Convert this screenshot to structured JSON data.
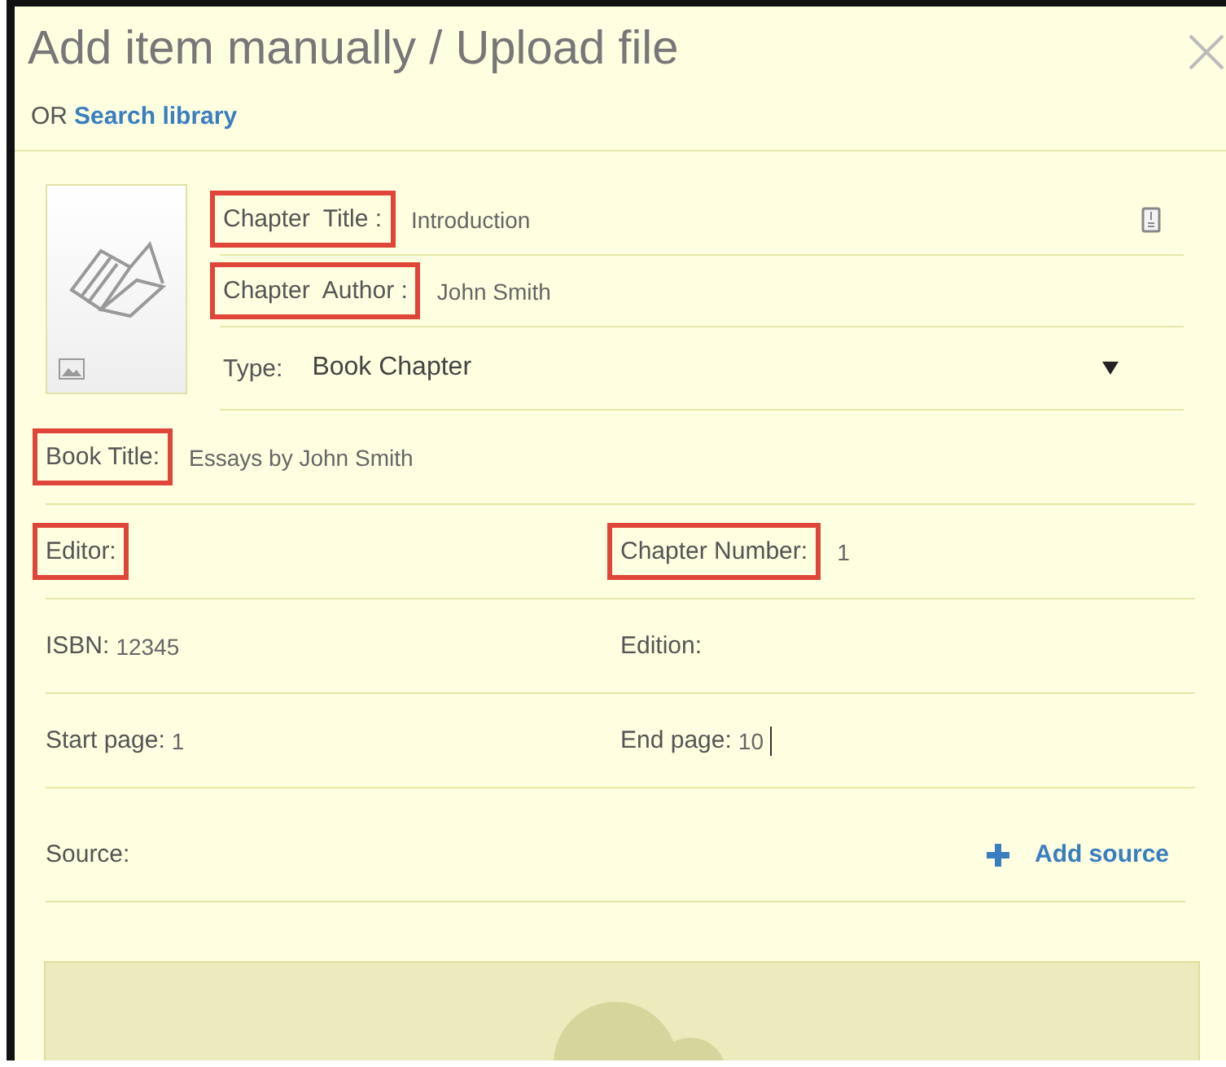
{
  "dialog": {
    "title": "Add item manually / Upload file",
    "or_text": "OR",
    "search_link": "Search library"
  },
  "header_fields": [
    {
      "kind": "text",
      "label": "Chapter  Title :",
      "value": "Introduction",
      "highlighted": true
    },
    {
      "kind": "text",
      "label": "Chapter  Author :",
      "value": "John Smith",
      "highlighted": true
    },
    {
      "kind": "select",
      "label": "Type:",
      "value": "Book Chapter"
    }
  ],
  "rows": [
    [
      {
        "label": "Book Title:",
        "value": "Essays by John Smith",
        "highlighted": true
      }
    ],
    [
      {
        "label": "Editor:",
        "highlighted": true
      },
      {
        "label": "Chapter Number:",
        "value": "1",
        "highlighted": true
      }
    ],
    [
      {
        "label": "ISBN:",
        "value": "12345"
      },
      {
        "label": "Edition:"
      }
    ],
    [
      {
        "label": "Start page:",
        "value": "1"
      },
      {
        "label": "End page:",
        "value": "10",
        "focused": true
      }
    ]
  ],
  "source": {
    "label": "Source:",
    "add_label": "Add source"
  }
}
